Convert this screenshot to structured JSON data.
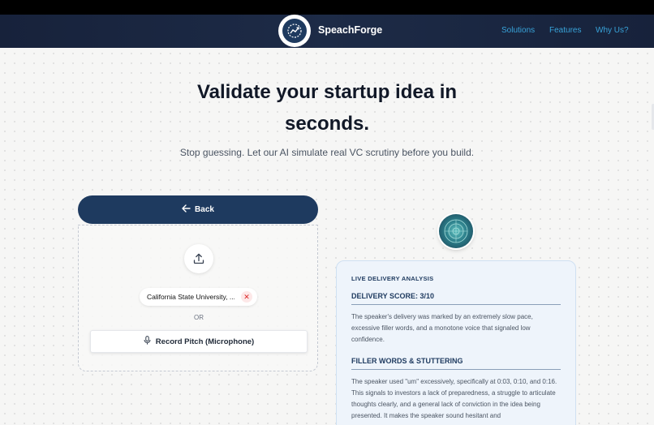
{
  "nav": {
    "brand": "SpeachForge",
    "links": [
      "Solutions",
      "Features",
      "Why Us?"
    ]
  },
  "hero": {
    "title": "Validate your startup idea in seconds.",
    "subtitle": "Stop guessing. Let our AI simulate real VC scrutiny before you build."
  },
  "upload": {
    "back_label": "Back",
    "file_name": "California State University, ...",
    "or_label": "OR",
    "record_label": "Record Pitch (Microphone)"
  },
  "analysis": {
    "label": "LIVE DELIVERY ANALYSIS",
    "score_heading": "DELIVERY SCORE: 3/10",
    "score_text": "The speaker's delivery was marked by an extremely slow pace, excessive filler words, and a monotone voice that signaled low confidence.",
    "filler_heading": "FILLER WORDS & STUTTERING",
    "filler_text": "The speaker used \"um\" excessively, specifically at 0:03, 0:10, and 0:16. This signals to investors a lack of preparedness, a struggle to articulate thoughts clearly, and a general lack of conviction in the idea being presented. It makes the speaker sound hesitant and"
  },
  "colors": {
    "navy": "#1e3a5f",
    "link": "#38a3d9",
    "danger": "#dc2626"
  }
}
